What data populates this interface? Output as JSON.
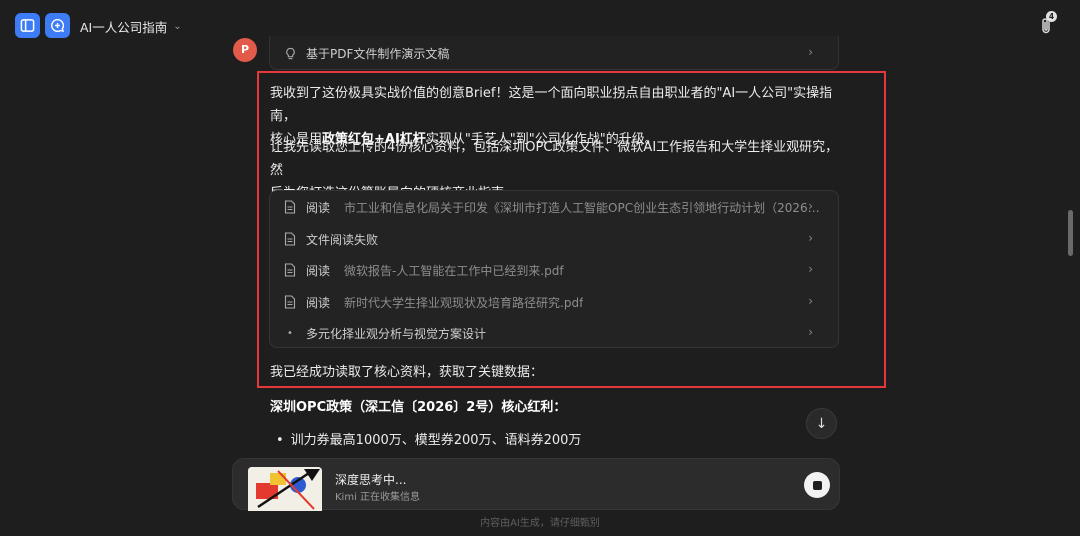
{
  "header": {
    "title": "AI一人公司指南",
    "attachment_count": "4"
  },
  "avatar": {
    "letter": "P"
  },
  "top_step": {
    "label": "基于PDF文件制作演示文稿"
  },
  "message": {
    "para1_a": "我收到了这份极具实战价值的创意Brief！这是一个面向职业拐点自由职业者的\"AI一人公司\"实操指南，",
    "para1_b_pre": "核心是用",
    "para1_b_bold1": "政策红包+AI杠杆",
    "para1_b_post": "实现从\"手艺人\"到\"公司化作战\"的升级。",
    "para2_a": "让我先读取您上传的4份核心资料，包括深圳OPC政策文件、微软AI工作报告和大学生择业观研究，然",
    "para2_b": "后为您打造这份算账导向的硬核商业指南。",
    "para3": "我已经成功读取了核心资料，获取了关键数据："
  },
  "steps": [
    {
      "verb": "阅读",
      "file": "市工业和信息化局关于印发《深圳市打造人工智能OPC创业生态引领地行动计划（2026—2027...",
      "icon": "document-icon"
    },
    {
      "verb": "文件阅读失败",
      "file": "",
      "icon": "document-icon"
    },
    {
      "verb": "阅读",
      "file": "微软报告-人工智能在工作中已经到来.pdf",
      "icon": "document-icon"
    },
    {
      "verb": "阅读",
      "file": "新时代大学生择业观现状及培育路径研究.pdf",
      "icon": "document-icon"
    },
    {
      "verb": "多元化择业观分析与视觉方案设计",
      "file": "",
      "icon": "bullet-dot"
    }
  ],
  "policy": {
    "title": "深圳OPC政策（深工信〔2026〕2号）核心红利：",
    "item1": "训力券最高1000万、模型券200万、语料券200万"
  },
  "thinking": {
    "title": "深度思考中...",
    "subtitle": "Kimi 正在收集信息"
  },
  "footer": {
    "note": "内容由AI生成，请仔细甄别"
  },
  "colors": {
    "accent": "#3d7cf5",
    "highlight_border": "#e5383b",
    "background": "#1e1e1e"
  }
}
